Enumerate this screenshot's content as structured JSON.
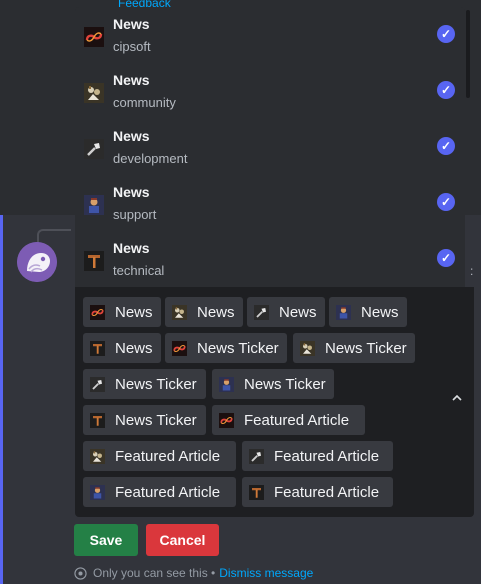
{
  "background": {
    "link_fragment": "Feedback"
  },
  "dropdown_options": [
    {
      "label": "News",
      "description": "cipsoft",
      "icon": "cipsoft-logo-icon",
      "selected": true
    },
    {
      "label": "News",
      "description": "community",
      "icon": "community-icon",
      "selected": true
    },
    {
      "label": "News",
      "description": "development",
      "icon": "development-icon",
      "selected": true
    },
    {
      "label": "News",
      "description": "support",
      "icon": "support-icon",
      "selected": true
    },
    {
      "label": "News",
      "description": "technical",
      "icon": "technical-icon",
      "selected": true
    }
  ],
  "selected_chips": [
    {
      "label": "News",
      "icon": "cipsoft-logo-icon"
    },
    {
      "label": "News",
      "icon": "community-icon"
    },
    {
      "label": "News",
      "icon": "development-icon"
    },
    {
      "label": "News",
      "icon": "support-icon"
    },
    {
      "label": "News",
      "icon": "technical-icon"
    },
    {
      "label": "News Ticker",
      "icon": "cipsoft-logo-icon"
    },
    {
      "label": "News Ticker",
      "icon": "community-icon"
    },
    {
      "label": "News Ticker",
      "icon": "development-icon"
    },
    {
      "label": "News Ticker",
      "icon": "support-icon"
    },
    {
      "label": "News Ticker",
      "icon": "technical-icon"
    },
    {
      "label": "Featured Article",
      "icon": "cipsoft-logo-icon"
    },
    {
      "label": "Featured Article",
      "icon": "community-icon"
    },
    {
      "label": "Featured Article",
      "icon": "development-icon"
    },
    {
      "label": "Featured Article",
      "icon": "support-icon"
    },
    {
      "label": "Featured Article",
      "icon": "technical-icon"
    }
  ],
  "buttons": {
    "save_label": "Save",
    "cancel_label": "Cancel"
  },
  "ephemeral": {
    "note": "Only you can see this •",
    "dismiss_label": "Dismiss message"
  },
  "colors": {
    "accent": "#5865f2",
    "save": "#248046",
    "cancel": "#da373c",
    "link": "#00a8fc"
  }
}
